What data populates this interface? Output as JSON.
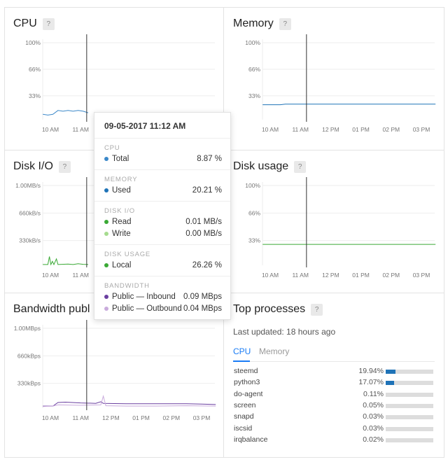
{
  "panels": {
    "cpu": {
      "title": "CPU",
      "help": "?"
    },
    "memory": {
      "title": "Memory",
      "help": "?"
    },
    "disk_io": {
      "title": "Disk I/O",
      "help": "?"
    },
    "disk_usage": {
      "title": "Disk usage",
      "help": "?"
    },
    "bandwidth": {
      "title": "Bandwidth publ",
      "help": "?"
    },
    "top_processes": {
      "title": "Top processes",
      "help": "?"
    }
  },
  "x_ticks": [
    "10 AM",
    "11 AM",
    "12 PM",
    "01 PM",
    "02 PM",
    "03 PM"
  ],
  "crosshair_time": "11:12",
  "colors": {
    "cpu": "#3b88c9",
    "memory": "#1f73b7",
    "disk_read": "#3aa935",
    "disk_write": "#a6dc8f",
    "disk_local": "#3aa935",
    "inbound": "#6a3fa0",
    "outbound": "#c9abdc",
    "accent": "#1a7cf5"
  },
  "chart_data": [
    {
      "id": "cpu",
      "type": "line",
      "y_ticks": [
        "100%",
        "66%",
        "33%"
      ],
      "ylim": [
        0,
        100
      ],
      "series": [
        {
          "color_key": "cpu",
          "points": [
            [
              "09:45",
              7
            ],
            [
              "09:55",
              6
            ],
            [
              "10:05",
              7
            ],
            [
              "10:15",
              12
            ],
            [
              "10:25",
              11
            ],
            [
              "10:35",
              12
            ],
            [
              "10:45",
              11
            ],
            [
              "10:55",
              12
            ],
            [
              "11:05",
              11
            ],
            [
              "11:15",
              9
            ]
          ]
        }
      ]
    },
    {
      "id": "memory",
      "type": "line",
      "y_ticks": [
        "100%",
        "66%",
        "33%"
      ],
      "ylim": [
        0,
        100
      ],
      "series": [
        {
          "color_key": "memory",
          "points": [
            [
              "09:45",
              19.5
            ],
            [
              "10:20",
              19.5
            ],
            [
              "10:30",
              20.2
            ],
            [
              "15:28",
              20.2
            ]
          ]
        }
      ]
    },
    {
      "id": "disk_io",
      "type": "line",
      "y_ticks": [
        "1.00MB/s",
        "660kB/s",
        "330kB/s"
      ],
      "ylim": [
        0,
        1000
      ],
      "series": [
        {
          "color_key": "disk_read",
          "points": [
            [
              "09:45",
              10
            ],
            [
              "09:55",
              10
            ],
            [
              "09:58",
              110
            ],
            [
              "10:01",
              10
            ],
            [
              "10:04",
              50
            ],
            [
              "10:07",
              10
            ],
            [
              "10:12",
              80
            ],
            [
              "10:15",
              10
            ],
            [
              "10:35",
              15
            ],
            [
              "10:45",
              10
            ],
            [
              "10:55",
              20
            ],
            [
              "11:05",
              12
            ],
            [
              "11:15",
              10
            ]
          ]
        }
      ]
    },
    {
      "id": "disk_usage",
      "type": "line",
      "y_ticks": [
        "100%",
        "66%",
        "33%"
      ],
      "ylim": [
        0,
        100
      ],
      "series": [
        {
          "color_key": "disk_local",
          "points": [
            [
              "09:45",
              26.26
            ],
            [
              "15:28",
              26.26
            ]
          ]
        }
      ]
    },
    {
      "id": "bandwidth",
      "type": "line",
      "y_ticks": [
        "1.00MBps",
        "660kBps",
        "330kBps"
      ],
      "ylim": [
        0,
        1000
      ],
      "series": [
        {
          "color_key": "inbound",
          "points": [
            [
              "09:45",
              25
            ],
            [
              "10:05",
              25
            ],
            [
              "10:15",
              70
            ],
            [
              "10:30",
              75
            ],
            [
              "11:00",
              65
            ],
            [
              "11:30",
              60
            ],
            [
              "11:40",
              80
            ],
            [
              "11:45",
              60
            ],
            [
              "12:30",
              55
            ],
            [
              "13:30",
              55
            ],
            [
              "14:30",
              55
            ],
            [
              "15:00",
              50
            ],
            [
              "15:28",
              45
            ]
          ]
        },
        {
          "color_key": "outbound",
          "points": [
            [
              "09:45",
              20
            ],
            [
              "10:05",
              25
            ],
            [
              "10:15",
              40
            ],
            [
              "11:00",
              35
            ],
            [
              "11:40",
              40
            ],
            [
              "11:45",
              150
            ],
            [
              "11:50",
              30
            ],
            [
              "12:30",
              25
            ],
            [
              "13:30",
              25
            ],
            [
              "14:30",
              30
            ],
            [
              "15:28",
              25
            ]
          ]
        }
      ]
    }
  ],
  "tooltip": {
    "date": "09-05-2017 11:12 AM",
    "sections": [
      {
        "label": "CPU",
        "rows": [
          {
            "name": "Total",
            "value": "8.87 %",
            "color_key": "cpu"
          }
        ]
      },
      {
        "label": "MEMORY",
        "rows": [
          {
            "name": "Used",
            "value": "20.21 %",
            "color_key": "memory"
          }
        ]
      },
      {
        "label": "DISK I/O",
        "rows": [
          {
            "name": "Read",
            "value": "0.01 MB/s",
            "color_key": "disk_read"
          },
          {
            "name": "Write",
            "value": "0.00 MB/s",
            "color_key": "disk_write"
          }
        ]
      },
      {
        "label": "DISK USAGE",
        "rows": [
          {
            "name": "Local",
            "value": "26.26 %",
            "color_key": "disk_local"
          }
        ]
      },
      {
        "label": "BANDWIDTH",
        "rows": [
          {
            "name": "Public — Inbound",
            "value": "0.09 MBps",
            "color_key": "inbound"
          },
          {
            "name": "Public — Outbound",
            "value": "0.04 MBps",
            "color_key": "outbound"
          }
        ]
      }
    ]
  },
  "top_processes": {
    "last_updated": "Last updated: 18 hours ago",
    "tabs": [
      "CPU",
      "Memory"
    ],
    "active_tab": "CPU",
    "rows": [
      {
        "name": "steemd",
        "value": "19.94%",
        "pct": 19.94
      },
      {
        "name": "python3",
        "value": "17.07%",
        "pct": 17.07
      },
      {
        "name": "do-agent",
        "value": "0.11%",
        "pct": 0.11
      },
      {
        "name": "screen",
        "value": "0.05%",
        "pct": 0.05
      },
      {
        "name": "snapd",
        "value": "0.03%",
        "pct": 0.03
      },
      {
        "name": "iscsid",
        "value": "0.03%",
        "pct": 0.03
      },
      {
        "name": "irqbalance",
        "value": "0.02%",
        "pct": 0.02
      }
    ]
  }
}
